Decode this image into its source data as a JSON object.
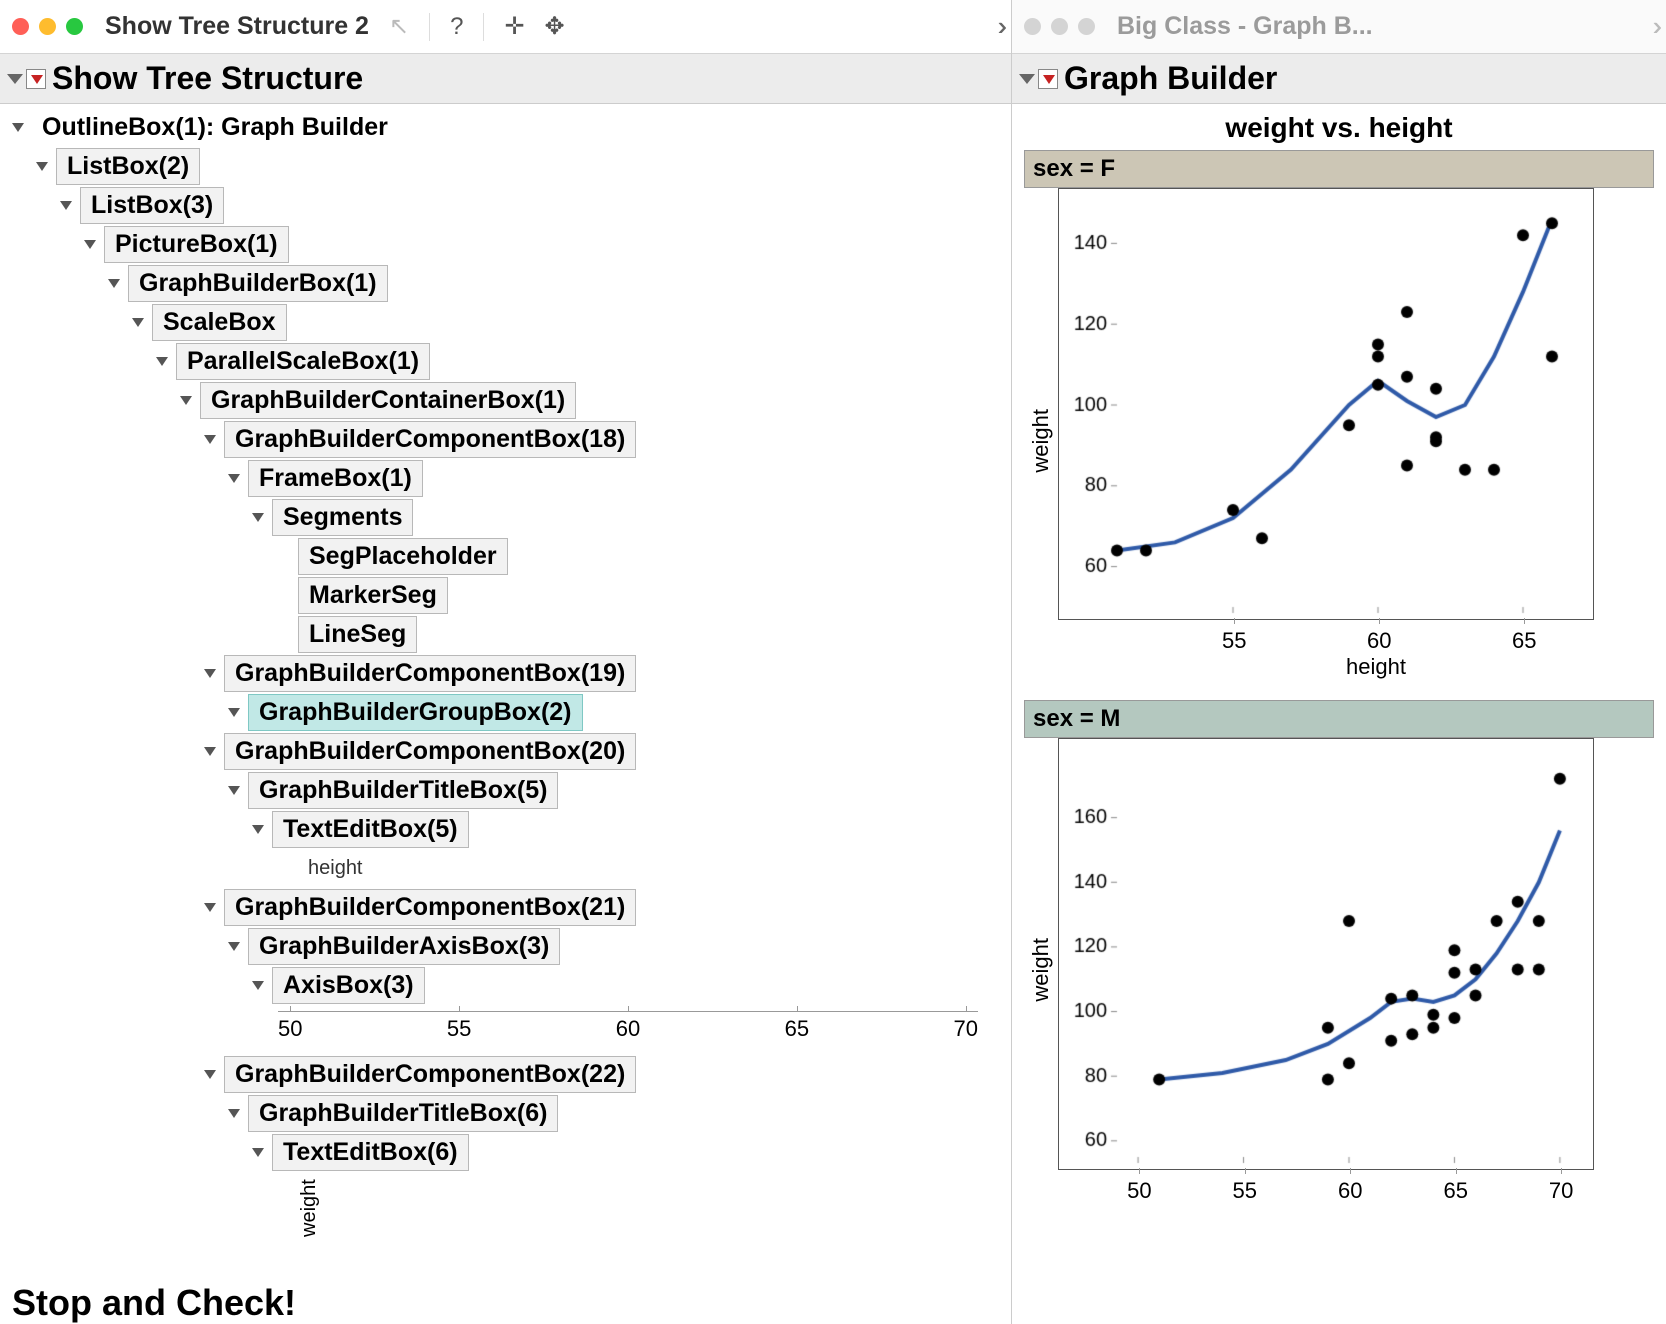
{
  "left_title": "Show Tree Structure 2",
  "right_title": "Big Class - Graph B...",
  "left_pane_header": "Show Tree Structure",
  "right_pane_header": "Graph Builder",
  "chart_title": "weight vs. height",
  "group_f": "sex = F",
  "group_m": "sex = M",
  "xlab": "height",
  "ylab": "weight",
  "tree": [
    {
      "indent": 0,
      "disc": true,
      "box": false,
      "label": "OutlineBox(1): Graph Builder"
    },
    {
      "indent": 1,
      "disc": true,
      "box": true,
      "label": "ListBox(2)"
    },
    {
      "indent": 2,
      "disc": true,
      "box": true,
      "label": "ListBox(3)"
    },
    {
      "indent": 3,
      "disc": true,
      "box": true,
      "label": "PictureBox(1)"
    },
    {
      "indent": 4,
      "disc": true,
      "box": true,
      "label": "GraphBuilderBox(1)"
    },
    {
      "indent": 5,
      "disc": true,
      "box": true,
      "label": "ScaleBox"
    },
    {
      "indent": 6,
      "disc": true,
      "box": true,
      "label": "ParallelScaleBox(1)"
    },
    {
      "indent": 7,
      "disc": true,
      "box": true,
      "label": "GraphBuilderContainerBox(1)"
    },
    {
      "indent": 8,
      "disc": true,
      "box": true,
      "label": "GraphBuilderComponentBox(18)"
    },
    {
      "indent": 9,
      "disc": true,
      "box": true,
      "label": "FrameBox(1)"
    },
    {
      "indent": 10,
      "disc": true,
      "box": true,
      "label": "Segments"
    },
    {
      "indent": 11,
      "disc": false,
      "box": true,
      "label": "SegPlaceholder"
    },
    {
      "indent": 11,
      "disc": false,
      "box": true,
      "label": "MarkerSeg"
    },
    {
      "indent": 11,
      "disc": false,
      "box": true,
      "label": "LineSeg"
    },
    {
      "indent": 8,
      "disc": true,
      "box": true,
      "label": "GraphBuilderComponentBox(19)"
    },
    {
      "indent": 9,
      "disc": true,
      "box": true,
      "label": "GraphBuilderGroupBox(2)",
      "highlight": true
    },
    {
      "indent": 8,
      "disc": true,
      "box": true,
      "label": "GraphBuilderComponentBox(20)"
    },
    {
      "indent": 9,
      "disc": true,
      "box": true,
      "label": "GraphBuilderTitleBox(5)"
    },
    {
      "indent": 10,
      "disc": true,
      "box": true,
      "label": "TextEditBox(5)"
    },
    {
      "indent": 11,
      "disc": false,
      "box": false,
      "small": true,
      "label": "height"
    },
    {
      "indent": 8,
      "disc": true,
      "box": true,
      "label": "GraphBuilderComponentBox(21)"
    },
    {
      "indent": 9,
      "disc": true,
      "box": true,
      "label": "GraphBuilderAxisBox(3)"
    },
    {
      "indent": 10,
      "disc": true,
      "box": true,
      "label": "AxisBox(3)"
    },
    {
      "indent": 10,
      "disc": false,
      "axis": true,
      "ticks": [
        "50",
        "55",
        "60",
        "65",
        "70"
      ]
    },
    {
      "indent": 8,
      "disc": true,
      "box": true,
      "label": "GraphBuilderComponentBox(22)"
    },
    {
      "indent": 9,
      "disc": true,
      "box": true,
      "label": "GraphBuilderTitleBox(6)"
    },
    {
      "indent": 10,
      "disc": true,
      "box": true,
      "label": "TextEditBox(6)"
    },
    {
      "indent": 11,
      "disc": false,
      "box": false,
      "rotated": true,
      "label": "weight"
    }
  ],
  "cutoff_text": "Stop and Check!",
  "chart_data": [
    {
      "type": "scatter",
      "title": "sex = F",
      "xlabel": "height",
      "ylabel": "weight",
      "xlim": [
        51,
        67
      ],
      "ylim": [
        50,
        150
      ],
      "xticks": [
        55,
        60,
        65
      ],
      "yticks": [
        60,
        80,
        100,
        120,
        140
      ],
      "points": [
        {
          "x": 51,
          "y": 64
        },
        {
          "x": 52,
          "y": 64
        },
        {
          "x": 55,
          "y": 74
        },
        {
          "x": 56,
          "y": 67
        },
        {
          "x": 59,
          "y": 95
        },
        {
          "x": 60,
          "y": 105
        },
        {
          "x": 60,
          "y": 112
        },
        {
          "x": 60,
          "y": 115
        },
        {
          "x": 61,
          "y": 85
        },
        {
          "x": 61,
          "y": 107
        },
        {
          "x": 61,
          "y": 123
        },
        {
          "x": 62,
          "y": 92
        },
        {
          "x": 62,
          "y": 104
        },
        {
          "x": 62,
          "y": 91
        },
        {
          "x": 63,
          "y": 84
        },
        {
          "x": 64,
          "y": 84
        },
        {
          "x": 65,
          "y": 142
        },
        {
          "x": 66,
          "y": 112
        },
        {
          "x": 66,
          "y": 145
        }
      ],
      "smooth": [
        {
          "x": 51,
          "y": 64
        },
        {
          "x": 53,
          "y": 66
        },
        {
          "x": 55,
          "y": 72
        },
        {
          "x": 57,
          "y": 84
        },
        {
          "x": 59,
          "y": 100
        },
        {
          "x": 60,
          "y": 106
        },
        {
          "x": 61,
          "y": 101
        },
        {
          "x": 62,
          "y": 97
        },
        {
          "x": 63,
          "y": 100
        },
        {
          "x": 64,
          "y": 112
        },
        {
          "x": 65,
          "y": 128
        },
        {
          "x": 66,
          "y": 146
        }
      ]
    },
    {
      "type": "scatter",
      "title": "sex = M",
      "xlabel": "height",
      "ylabel": "weight",
      "xlim": [
        49,
        71
      ],
      "ylim": [
        55,
        180
      ],
      "xticks": [
        50,
        55,
        60,
        65,
        70
      ],
      "yticks": [
        60,
        80,
        100,
        120,
        140,
        160
      ],
      "points": [
        {
          "x": 51,
          "y": 79
        },
        {
          "x": 59,
          "y": 79
        },
        {
          "x": 60,
          "y": 84
        },
        {
          "x": 59,
          "y": 95
        },
        {
          "x": 60,
          "y": 128
        },
        {
          "x": 62,
          "y": 104
        },
        {
          "x": 62,
          "y": 91
        },
        {
          "x": 63,
          "y": 93
        },
        {
          "x": 63,
          "y": 105
        },
        {
          "x": 64,
          "y": 99
        },
        {
          "x": 64,
          "y": 95
        },
        {
          "x": 65,
          "y": 98
        },
        {
          "x": 65,
          "y": 112
        },
        {
          "x": 65,
          "y": 119
        },
        {
          "x": 66,
          "y": 105
        },
        {
          "x": 66,
          "y": 113
        },
        {
          "x": 67,
          "y": 128
        },
        {
          "x": 68,
          "y": 113
        },
        {
          "x": 68,
          "y": 134
        },
        {
          "x": 69,
          "y": 113
        },
        {
          "x": 69,
          "y": 128
        },
        {
          "x": 70,
          "y": 172
        }
      ],
      "smooth": [
        {
          "x": 51,
          "y": 79
        },
        {
          "x": 54,
          "y": 81
        },
        {
          "x": 57,
          "y": 85
        },
        {
          "x": 59,
          "y": 90
        },
        {
          "x": 61,
          "y": 98
        },
        {
          "x": 62,
          "y": 103
        },
        {
          "x": 63,
          "y": 104
        },
        {
          "x": 64,
          "y": 103
        },
        {
          "x": 65,
          "y": 105
        },
        {
          "x": 66,
          "y": 110
        },
        {
          "x": 67,
          "y": 118
        },
        {
          "x": 68,
          "y": 128
        },
        {
          "x": 69,
          "y": 140
        },
        {
          "x": 70,
          "y": 156
        }
      ]
    }
  ]
}
